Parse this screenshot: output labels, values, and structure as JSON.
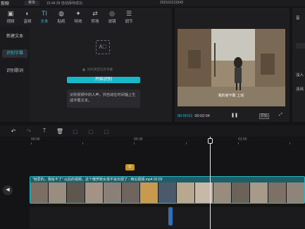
{
  "app": {
    "logo_text": "剪映",
    "menu_label": "菜单",
    "status": "15:46:39 自动保存成功",
    "title": "202101211543"
  },
  "tools": [
    {
      "icon": "▣",
      "label": "视频"
    },
    {
      "icon": "◐",
      "label": "音频"
    },
    {
      "icon": "TI",
      "label": "文本"
    },
    {
      "icon": "◍",
      "label": "贴纸"
    },
    {
      "icon": "✦",
      "label": "特效"
    },
    {
      "icon": "⇄",
      "label": "转场"
    },
    {
      "icon": "◎",
      "label": "滤镜"
    },
    {
      "icon": "☰",
      "label": "调节"
    }
  ],
  "sidebar": {
    "items": [
      {
        "label": "新建文本"
      },
      {
        "label": "识别字幕"
      },
      {
        "label": "识别歌词"
      }
    ]
  },
  "subtitle_panel": {
    "placeholder_icon": "A⃝",
    "clear_option": "同时清空已有字幕",
    "start_button": "开始识别",
    "description": "识别视频中的人声，并自动在时间轴上生成字幕文本。"
  },
  "preview": {
    "current_time": "00:00:51",
    "total_time": "00:02:04",
    "pause_icon": "❚❚",
    "original_label": "原始",
    "fullscreen_icon": "⤢",
    "caption": "我的家不敢 上动"
  },
  "right_panel": {
    "item1": "音",
    "item2": "淡入",
    "item3": "淡出"
  },
  "timeline_toolbar": [
    {
      "icon": "↶",
      "enabled": true
    },
    {
      "icon": "↷",
      "enabled": false
    },
    {
      "icon": "⟙",
      "enabled": true
    },
    {
      "icon": "🗑",
      "enabled": true
    },
    {
      "icon": "▢",
      "enabled": false
    },
    {
      "icon": "▢",
      "enabled": false
    },
    {
      "icon": "▢",
      "enabled": false
    }
  ],
  "ruler": {
    "labels": [
      "00:00",
      "00:30",
      "01:00"
    ]
  },
  "track": {
    "clip_title": "\"她爱的，我给不了\" 以后的视频，这个俄罗斯女孩不会出现了 - 西瓜视频.mp4   02:03",
    "original_marker": "⊙",
    "track_icon": "◀"
  },
  "colors": {
    "accent": "#21c4d2",
    "clip_border": "#25b8c6",
    "marker": "#c9952a"
  }
}
